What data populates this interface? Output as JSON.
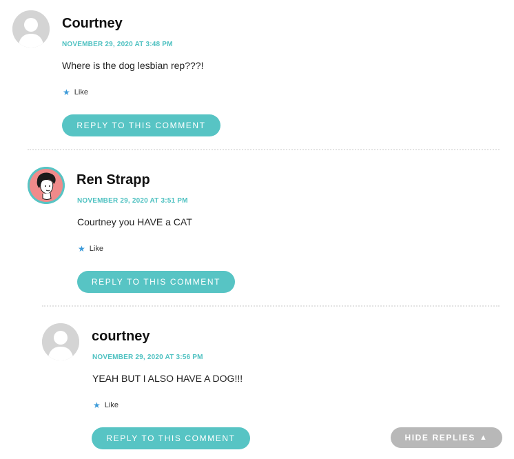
{
  "comments": [
    {
      "author": "Courtney",
      "date": "NOVEMBER 29, 2020 AT 3:48 PM",
      "text": "Where is the dog lesbian rep???!",
      "like_label": "Like",
      "reply_label": "REPLY TO THIS COMMENT",
      "avatar": "default-avatar-icon"
    },
    {
      "author": "Ren Strapp",
      "date": "NOVEMBER 29, 2020 AT 3:51 PM",
      "text": "Courtney you HAVE a CAT",
      "like_label": "Like",
      "reply_label": "REPLY TO THIS COMMENT",
      "avatar": "illustrated-portrait-avatar"
    },
    {
      "author": "courtney",
      "date": "NOVEMBER 29, 2020 AT 3:56 PM",
      "text": "YEAH BUT I ALSO HAVE A DOG!!!",
      "like_label": "Like",
      "reply_label": "REPLY TO THIS COMMENT",
      "avatar": "default-avatar-icon"
    }
  ],
  "hide_replies_label": "HIDE REPLIES",
  "colors": {
    "accent": "#57c4c4",
    "date": "#4ec1c1",
    "like_star": "#3b9ad9",
    "hide_replies_bg": "#b8b8b8"
  }
}
